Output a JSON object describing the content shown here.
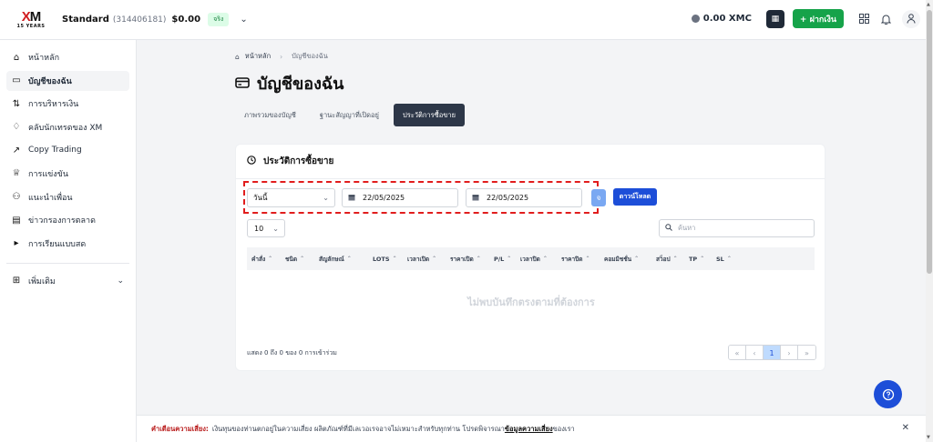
{
  "header": {
    "logo_text": "XM",
    "logo_sub": "15 YEARS",
    "account_type": "Standard",
    "account_number": "(314406181)",
    "balance": "$0.00",
    "account_badge": "จริง",
    "xmc_balance": "0.00 XMC",
    "deposit_label": "+ ฝากเงิน"
  },
  "sidebar": {
    "items": [
      {
        "label": "หน้าหลัก",
        "icon": "home-icon"
      },
      {
        "label": "บัญชีของฉัน",
        "icon": "card-icon"
      },
      {
        "label": "การบริหารเงิน",
        "icon": "transfer-icon"
      },
      {
        "label": "คลับนักเทรดของ XM",
        "icon": "diamond-icon"
      },
      {
        "label": "Copy Trading",
        "icon": "trend-icon"
      },
      {
        "label": "การแข่งขัน",
        "icon": "trophy-icon"
      },
      {
        "label": "แนะนำเพื่อน",
        "icon": "people-icon"
      },
      {
        "label": "ข่าวกรองการตลาด",
        "icon": "bank-icon"
      },
      {
        "label": "การเรียนแบบสด",
        "icon": "video-icon"
      }
    ],
    "more_label": "เพิ่มเติม"
  },
  "breadcrumb": {
    "home": "หน้าหลัก",
    "current": "บัญชีของฉัน"
  },
  "page": {
    "title": "บัญชีของฉัน"
  },
  "tabs": [
    {
      "label": "ภาพรวมของบัญชี"
    },
    {
      "label": "ฐานะสัญญาที่เปิดอยู่"
    },
    {
      "label": "ประวัติการซื้อขาย"
    }
  ],
  "card": {
    "title": "ประวัติการซื้อขาย",
    "period_value": "วันนี้",
    "date_from": "22/05/2025",
    "date_to": "22/05/2025",
    "search_btn_label": "จ",
    "download_label": "ดาวน์โหลด",
    "page_size": "10",
    "search_placeholder": "ค้นหา",
    "columns": [
      "คำสั่ง",
      "ชนิด",
      "สัญลักษณ์",
      "LOTS",
      "เวลาเปิด",
      "ราคาเปิด",
      "P/L",
      "เวลาปิด",
      "ราคาปิด",
      "คอมมิชชั่น",
      "สว็อป",
      "TP",
      "SL"
    ],
    "empty_text": "ไม่พบบันทึกตรงตามที่ต้องการ",
    "info_text": "แสดง 0 ถึง 0 ของ 0 การเข้าร่วม",
    "pager": {
      "first": "«",
      "prev": "‹",
      "current": "1",
      "next": "›",
      "last": "»"
    }
  },
  "warning": {
    "label": "คำเตือนความเสี่ยง:",
    "text": "เงินทุนของท่านตกอยู่ในความเสี่ยง ผลิตภัณฑ์ที่มีเลเวอเรจอาจไม่เหมาะสำหรับทุกท่าน โปรดพิจารณา",
    "link": "ข้อมูลความเสี่ยง",
    "suffix": "ของเรา"
  },
  "colors": {
    "accent_blue": "#1d4ed8",
    "deposit_green": "#16a34a",
    "highlight_red": "#e11d1d",
    "active_tab": "#2d3748"
  }
}
